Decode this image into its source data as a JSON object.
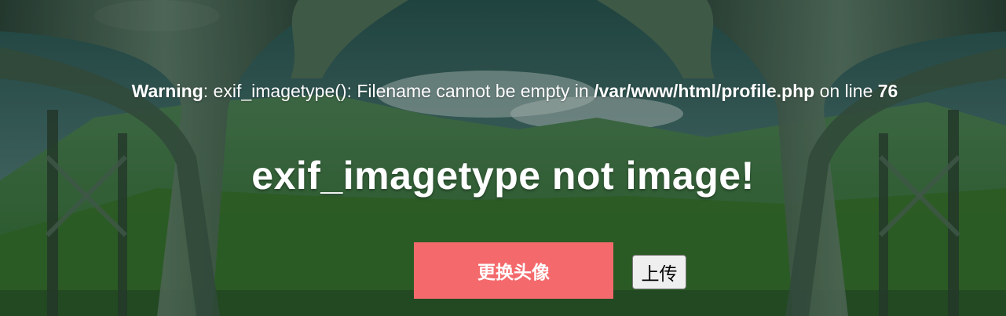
{
  "warning": {
    "prefix": "Warning",
    "message": ": exif_imagetype(): Filename cannot be empty in ",
    "file": "/var/www/html/profile.php",
    "middle": " on line ",
    "line": "76"
  },
  "headline": "exif_imagetype not image!",
  "buttons": {
    "change_avatar": "更换头像",
    "upload": "上传"
  },
  "colors": {
    "accent": "#f46a6c",
    "text": "#ffffff",
    "sky": "#2f5a55",
    "meadow": "#3f7a35"
  }
}
